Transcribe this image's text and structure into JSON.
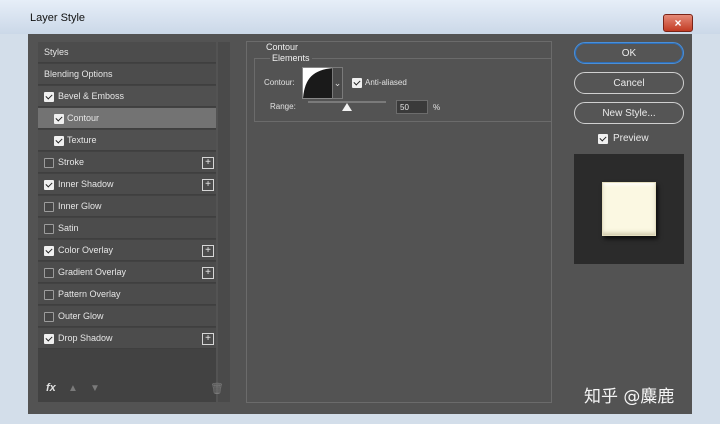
{
  "window": {
    "title": "Layer Style",
    "close_label": "×"
  },
  "styles_list": {
    "items": [
      {
        "label": "Styles",
        "checkbox": false,
        "checked": false,
        "plus": false,
        "sub": false,
        "state": "normal"
      },
      {
        "label": "Blending Options",
        "checkbox": false,
        "checked": false,
        "plus": false,
        "sub": false,
        "state": "normal"
      },
      {
        "label": "Bevel & Emboss",
        "checkbox": true,
        "checked": true,
        "plus": false,
        "sub": false,
        "state": "subsel"
      },
      {
        "label": "Contour",
        "checkbox": true,
        "checked": true,
        "plus": false,
        "sub": true,
        "state": "selected"
      },
      {
        "label": "Texture",
        "checkbox": true,
        "checked": true,
        "plus": false,
        "sub": true,
        "state": "subsel"
      },
      {
        "label": "Stroke",
        "checkbox": true,
        "checked": false,
        "plus": true,
        "sub": false,
        "state": "normal"
      },
      {
        "label": "Inner Shadow",
        "checkbox": true,
        "checked": true,
        "plus": true,
        "sub": false,
        "state": "normal"
      },
      {
        "label": "Inner Glow",
        "checkbox": true,
        "checked": false,
        "plus": false,
        "sub": false,
        "state": "normal"
      },
      {
        "label": "Satin",
        "checkbox": true,
        "checked": false,
        "plus": false,
        "sub": false,
        "state": "normal"
      },
      {
        "label": "Color Overlay",
        "checkbox": true,
        "checked": true,
        "plus": true,
        "sub": false,
        "state": "normal"
      },
      {
        "label": "Gradient Overlay",
        "checkbox": true,
        "checked": false,
        "plus": true,
        "sub": false,
        "state": "normal"
      },
      {
        "label": "Pattern Overlay",
        "checkbox": true,
        "checked": false,
        "plus": false,
        "sub": false,
        "state": "normal"
      },
      {
        "label": "Outer Glow",
        "checkbox": true,
        "checked": false,
        "plus": false,
        "sub": false,
        "state": "normal"
      },
      {
        "label": "Drop Shadow",
        "checkbox": true,
        "checked": true,
        "plus": true,
        "sub": false,
        "state": "normal"
      }
    ],
    "footer": {
      "fx_label": "fx",
      "up_icon": "arrow-up-icon",
      "down_icon": "arrow-down-icon",
      "trash_icon": "trash-icon"
    }
  },
  "contour_panel": {
    "group_title": "Contour",
    "elements_title": "Elements",
    "contour_label": "Contour:",
    "anti_aliased_label": "Anti-aliased",
    "anti_aliased_checked": true,
    "range_label": "Range:",
    "range_value": "50",
    "range_unit": "%",
    "range_fraction": 0.5
  },
  "buttons": {
    "ok": "OK",
    "cancel": "Cancel",
    "new_style": "New Style..."
  },
  "preview": {
    "label": "Preview",
    "checked": true,
    "swatch_color": "#fbf8e2"
  },
  "watermark": "知乎 @麋鹿"
}
